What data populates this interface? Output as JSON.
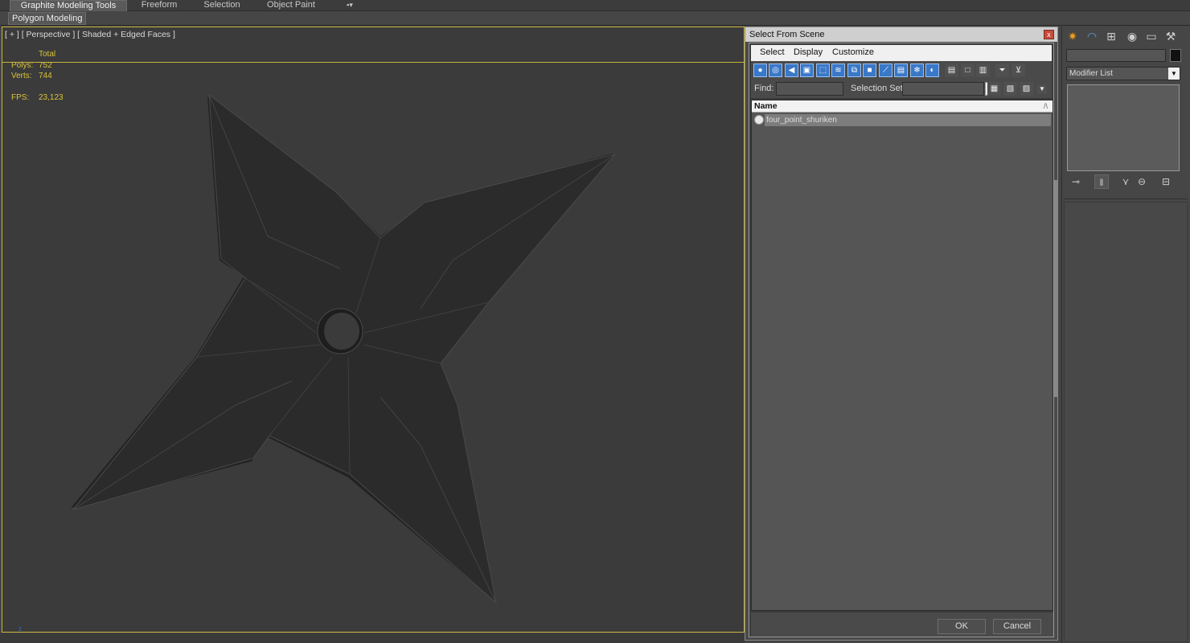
{
  "ribbon": {
    "tabs": [
      {
        "label": "Graphite Modeling Tools",
        "active": true
      },
      {
        "label": "Freeform",
        "active": false
      },
      {
        "label": "Selection",
        "active": false
      },
      {
        "label": "Object Paint",
        "active": false
      }
    ],
    "extra_icon": "▪▾",
    "sub_button": "Polygon Modeling"
  },
  "viewport": {
    "label": "[ + ] [ Perspective ] [ Shaded + Edged Faces ]",
    "stats": {
      "header": "Total",
      "polys_label": "Polys:",
      "polys_value": "752",
      "verts_label": "Verts:",
      "verts_value": "744",
      "fps_label": "FPS:",
      "fps_value": "23,123"
    },
    "axis_label": "z",
    "colors": {
      "border": "#c9b23a",
      "stats_text": "#d8c43c",
      "mesh": "#2c2c2c"
    }
  },
  "dialog": {
    "title": "Select From Scene",
    "close": "x",
    "menu": [
      "Select",
      "Display",
      "Customize"
    ],
    "toolbar_icons": [
      "geometry-icon",
      "shapes-icon",
      "lights-icon",
      "cameras-icon",
      "helpers-icon",
      "spacewarps-icon",
      "groups-icon",
      "xrefs-icon",
      "bones-icon",
      "containers-icon",
      "frozen-icon",
      "hidden-icon"
    ],
    "toolbar_glyphs": [
      "●",
      "◎",
      "◀",
      "▣",
      "⬚",
      "≋",
      "⧉",
      "■",
      "⟋",
      "▤",
      "❄",
      "◐"
    ],
    "find_label": "Find:",
    "find_value": "",
    "selset_label": "Selection Set:",
    "selset_value": "",
    "column_name": "Name",
    "rows": [
      {
        "name": "four_point_shuriken"
      }
    ],
    "ok": "OK",
    "cancel": "Cancel",
    "accent": "#3a78c8"
  },
  "command_panel": {
    "tab_icons": [
      "create-icon",
      "modify-icon",
      "hierarchy-icon",
      "motion-icon",
      "display-icon",
      "utilities-icon"
    ],
    "tab_glyphs": [
      "✷",
      "◠",
      "⊞",
      "◉",
      "▭",
      "⚒"
    ],
    "object_name": "",
    "modifier_list": "Modifier List",
    "stack_icons": [
      "pin-stack-icon",
      "show-end-result-icon",
      "make-unique-icon",
      "remove-modifier-icon",
      "configure-sets-icon"
    ],
    "stack_glyphs": [
      "⊸",
      "‖",
      "⋎",
      "⊖",
      "⊟"
    ]
  }
}
